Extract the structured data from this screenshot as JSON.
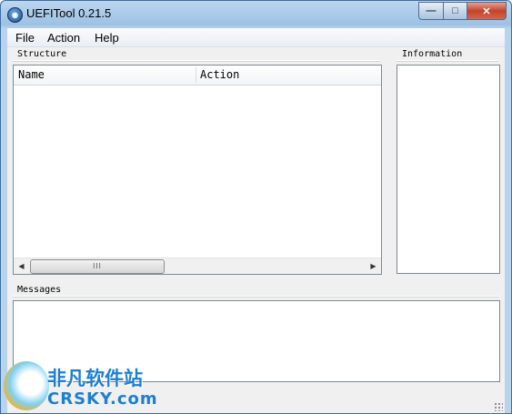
{
  "window": {
    "title": "UEFITool 0.21.5",
    "icon": "app-icon",
    "controls": {
      "minimize": "—",
      "maximize": "□",
      "close": "✕"
    }
  },
  "menubar": {
    "items": [
      {
        "label": "File"
      },
      {
        "label": "Action"
      },
      {
        "label": "Help"
      }
    ]
  },
  "structure": {
    "label": "Structure",
    "columns": [
      {
        "label": "Name"
      },
      {
        "label": "Action"
      }
    ],
    "scrollbar": {
      "left_arrow": "◀",
      "right_arrow": "▶",
      "thumb_grip": "III"
    }
  },
  "information": {
    "label": "Information"
  },
  "messages": {
    "label": "Messages"
  },
  "watermark": {
    "text_cn": "非凡软件站",
    "text_en": "CRSKY.com"
  }
}
